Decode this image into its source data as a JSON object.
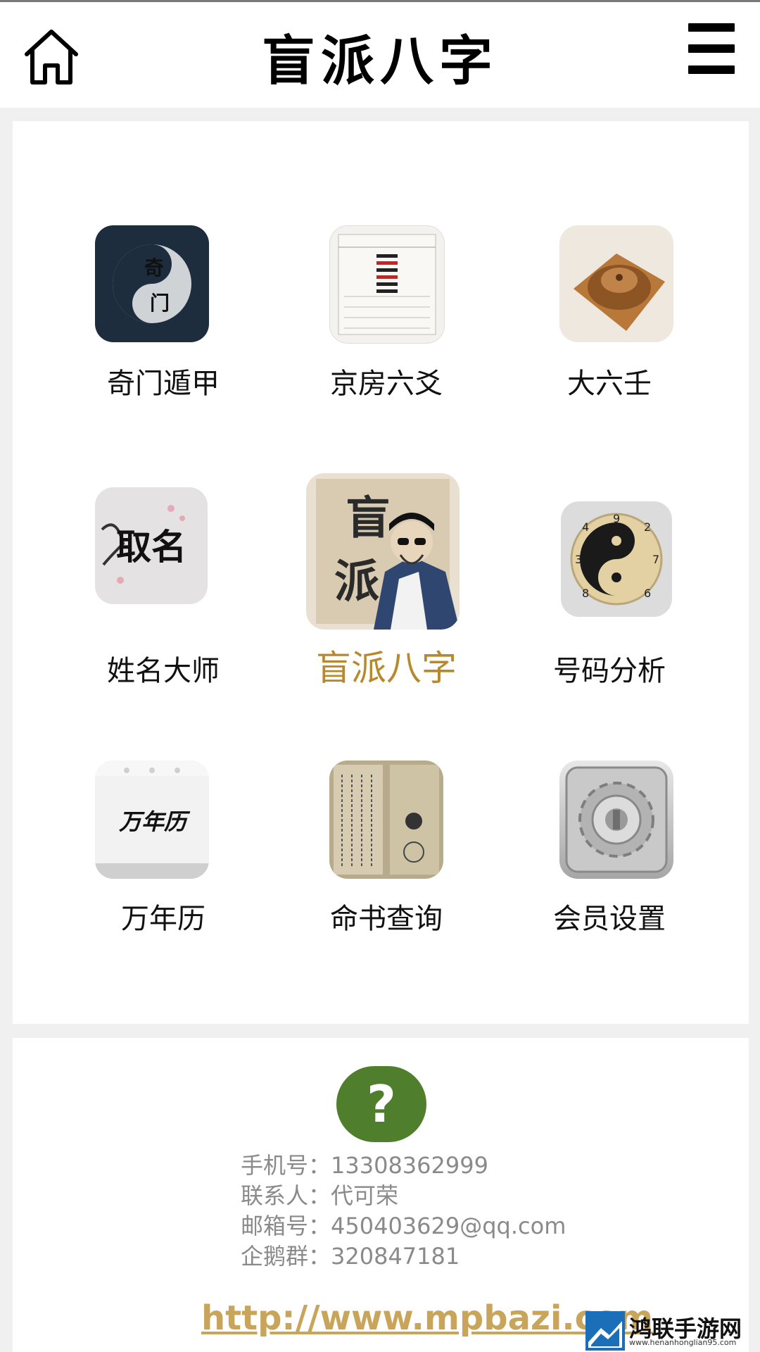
{
  "header": {
    "title": "盲派八字",
    "home_icon": "home-icon",
    "menu_icon": "hamburger-menu-icon"
  },
  "grid": [
    {
      "label": "奇门遁甲",
      "icon": "qimen-yinyang-icon"
    },
    {
      "label": "京房六爻",
      "icon": "liuyao-chart-icon"
    },
    {
      "label": "大六壬",
      "icon": "compass-board-icon"
    },
    {
      "label": "姓名大师",
      "icon": "quming-calligraphy-icon",
      "icon_text": "取名"
    },
    {
      "label": "盲派八字",
      "icon": "mangpai-master-icon",
      "active": true,
      "icon_text": "盲派"
    },
    {
      "label": "号码分析",
      "icon": "number-yinyang-icon"
    },
    {
      "label": "万年历",
      "icon": "calendar-icon",
      "icon_text": "万年历"
    },
    {
      "label": "命书查询",
      "icon": "ancient-book-icon"
    },
    {
      "label": "会员设置",
      "icon": "settings-gear-icon"
    }
  ],
  "colors": {
    "active_label": "#b8892a",
    "help_button": "#4f7f2c",
    "contact_text": "#8a8a8a",
    "link": "#c8a55a"
  },
  "footer": {
    "help_symbol": "?",
    "phone": "手机号：13308362999",
    "contact_person": "联系人：代可荣",
    "email": "邮箱号：450403629@qq.com",
    "qq_group": "企鹅群：320847181",
    "website": "http://www.mpbazi.com"
  },
  "watermark": {
    "name": "鸿联手游网",
    "url": "www.henanhonglian95.com"
  }
}
